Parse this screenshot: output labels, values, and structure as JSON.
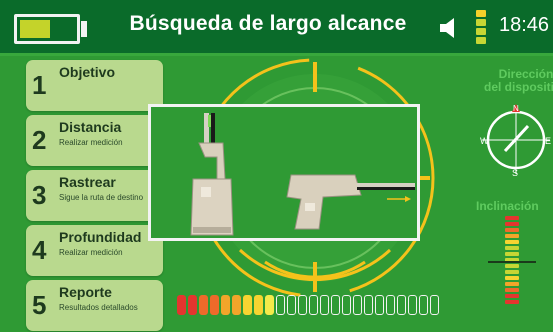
{
  "header": {
    "title": "Búsqueda de largo alcance",
    "time": "18:46",
    "battery_level": 0.55,
    "battery_color": "#c4d32a"
  },
  "menu": [
    {
      "number": "1",
      "label": "Objetivo",
      "sub": ""
    },
    {
      "number": "2",
      "label": "Distancia",
      "sub": "Realizar medición"
    },
    {
      "number": "3",
      "label": "Rastrear",
      "sub": "Sigue la ruta de destino"
    },
    {
      "number": "4",
      "label": "Profundidad",
      "sub": "Realizar medición"
    },
    {
      "number": "5",
      "label": "Reporte",
      "sub": "Resultados detallados"
    }
  ],
  "side": {
    "direction_label_1": "Dirección",
    "direction_label_2": "del dispositivo",
    "compass": {
      "n": "N",
      "s": "S",
      "w": "W",
      "e": "E"
    },
    "inclination_label": "Inclinación"
  },
  "signal_meter": {
    "segments_total": 24,
    "segments_filled": 9,
    "colors": [
      "#e4352e",
      "#ee6a2a",
      "#f2a52a",
      "#f7d431",
      "#f4ea4a"
    ]
  },
  "icons": {
    "speaker": "speaker-icon",
    "signal": "signal-strength-icon",
    "battery": "battery-icon",
    "compass": "compass-icon",
    "device_vertical": "device-vertical-icon",
    "device_horizontal": "device-horizontal-icon"
  },
  "colors": {
    "background": "#2f9a34",
    "topbar": "#0a6b2a",
    "menu": "#b9d98e",
    "accent_yellow": "#f4c21b",
    "label_green": "#5fcb5f"
  }
}
